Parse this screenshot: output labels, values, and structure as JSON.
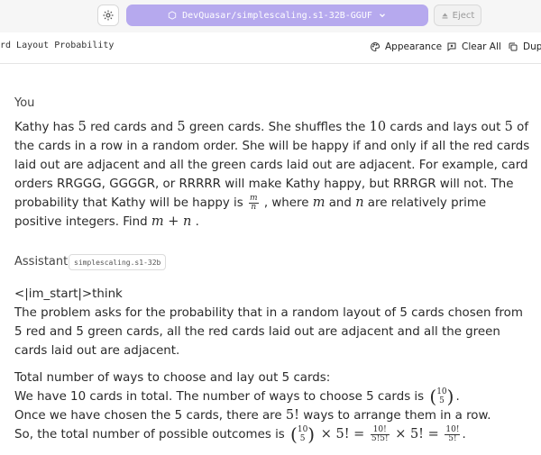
{
  "topbar": {
    "model_name": "DevQuasar/simplescaling.s1-32B-GGUF",
    "eject_label": "Eject",
    "icons": {
      "settings": "gear-icon",
      "model": "cube-icon",
      "dropdown": "chevron-down-icon",
      "eject": "eject-icon"
    }
  },
  "subbar": {
    "chat_title": "rd Layout Probability",
    "appearance_label": "Appearance",
    "clear_all_label": "Clear All",
    "duplicate_label": "Dup",
    "icons": {
      "appearance": "palette-icon",
      "clear_all": "clear-chat-icon",
      "duplicate": "duplicate-icon"
    }
  },
  "messages": {
    "user": {
      "role": "You",
      "text": {
        "p1": "Kathy has ",
        "n5a": "5",
        "p2": " red cards and ",
        "n5b": "5",
        "p3": " green cards. She shuffles the ",
        "n10": "10",
        "p4": " cards and lays out ",
        "n5c": "5",
        "p5": " of the cards in a row in a random order. She will be happy if and only if all the red cards laid out are adjacent and all the green cards laid out are adjacent. For example, card orders RRGGG, GGGGR, or RRRRR will make Kathy happy, but RRRGR will not. The probability that Kathy will be happy is ",
        "frac_num": "m",
        "frac_den": "n",
        "p6": " , where ",
        "m": "m",
        "p7": " and ",
        "n": "n",
        "p8": " are relatively prime positive integers. Find ",
        "sum": "m + n",
        "p9": " ."
      }
    },
    "assistant": {
      "role": "Assistant",
      "model_badge": "simplescaling.s1-32b",
      "think_tag": "<|im_start|>think",
      "intro": "The problem asks for the probability that in a random layout of 5 cards chosen from 5 red and 5 green cards, all the red cards laid out are adjacent and all the green cards laid out are adjacent.",
      "line1": "Total number of ways to choose and lay out 5 cards:",
      "line2_text": "We have 10 cards in total. The number of ways to choose 5 cards is ",
      "line2_end": ".",
      "line3_a": "Once we have chosen the 5 cards, there are ",
      "line3_math": "5!",
      "line3_b": " ways to arrange them in a row.",
      "line4_text": "So, the total number of possible outcomes is ",
      "line4_times": " × 5! = ",
      "frac1_num": "10!",
      "frac1_den": "5!5!",
      "line4_times2": " × 5! = ",
      "frac2_num": "10!",
      "frac2_den": "5!",
      "line4_end": ".",
      "binom_top": "10",
      "binom_bottom": "5",
      "paren_open": "(",
      "paren_close": ")"
    }
  }
}
